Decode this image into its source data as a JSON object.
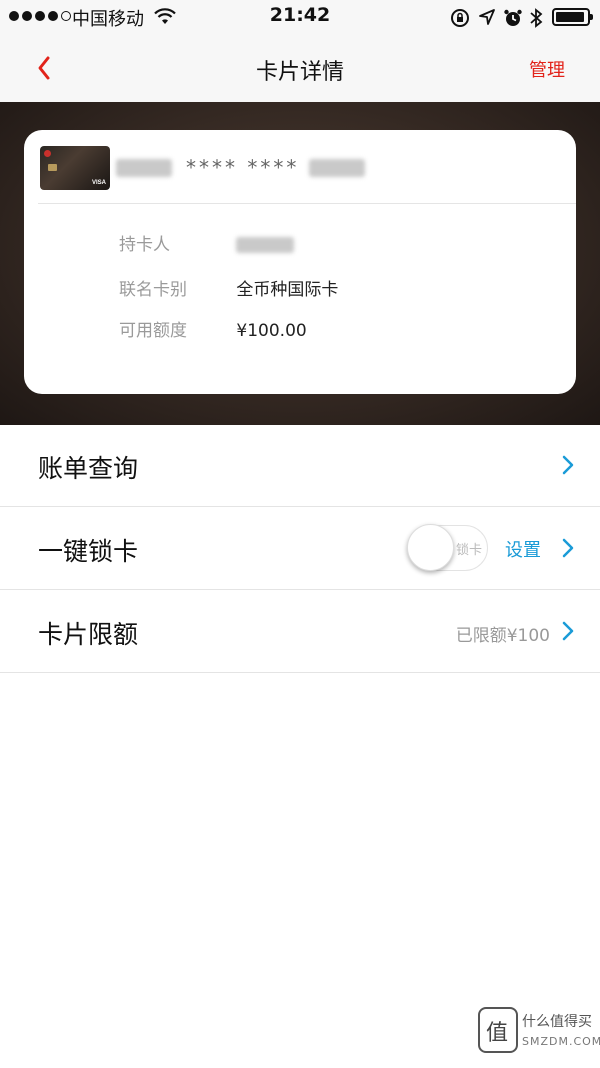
{
  "status_bar": {
    "carrier": "中国移动",
    "time": "21:42",
    "signal_filled": 4,
    "signal_total": 5
  },
  "nav": {
    "title": "卡片详情",
    "manage_label": "管理"
  },
  "card": {
    "number_masked": "**** ****",
    "info": [
      {
        "label": "持卡人",
        "value": ""
      },
      {
        "label": "联名卡别",
        "value": "全币种国际卡"
      },
      {
        "label": "可用额度",
        "value": "¥100.00"
      }
    ],
    "thumb_brand": "VISA"
  },
  "list": {
    "bill_query": "账单查询",
    "lock_card": "一键锁卡",
    "lock_toggle_text": "锁卡",
    "settings_label": "设置",
    "card_limit": "卡片限额",
    "limit_value": "已限额¥100"
  },
  "watermark": {
    "badge_char": "值",
    "name": "什么值得买",
    "domain": "SMZDM.COM"
  },
  "colors": {
    "accent_red": "#e2231a",
    "link_blue": "#1a9bd7"
  }
}
